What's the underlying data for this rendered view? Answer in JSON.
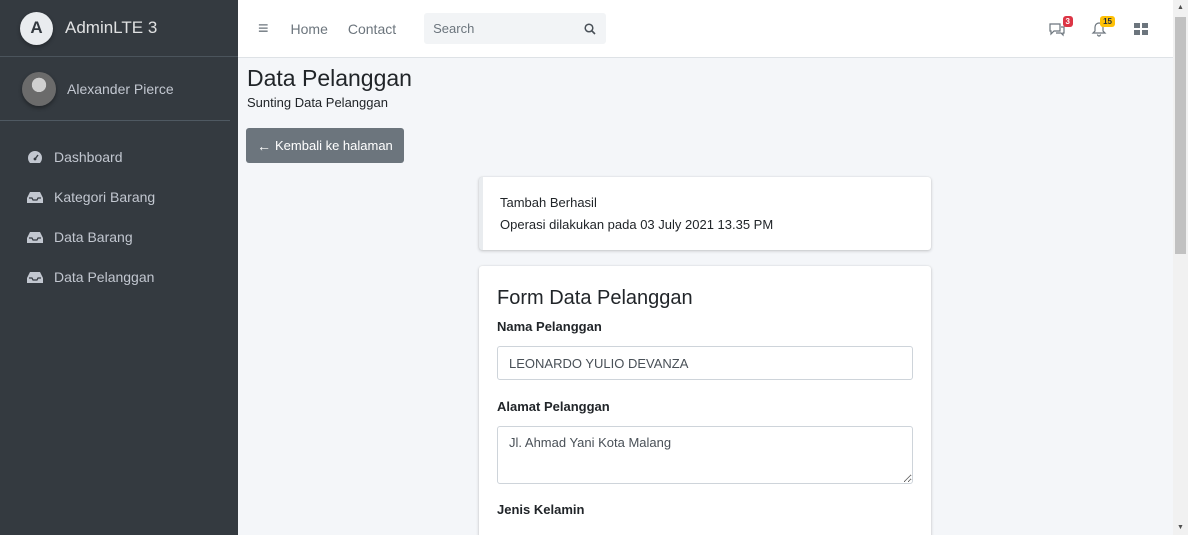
{
  "brand": {
    "name": "AdminLTE 3",
    "logo_letter": "A"
  },
  "user": {
    "name": "Alexander Pierce"
  },
  "sidebar": {
    "items": [
      {
        "label": "Dashboard",
        "icon": "tachometer-icon"
      },
      {
        "label": "Kategori Barang",
        "icon": "inbox-icon"
      },
      {
        "label": "Data Barang",
        "icon": "inbox-icon"
      },
      {
        "label": "Data Pelanggan",
        "icon": "inbox-icon"
      }
    ]
  },
  "topbar": {
    "hamburger_icon": "≡",
    "links": [
      "Home",
      "Contact"
    ],
    "search_placeholder": "Search",
    "messages_count": "3",
    "notifications_count": "15"
  },
  "page": {
    "title": "Data Pelanggan",
    "subtitle": "Sunting Data Pelanggan",
    "back_button": "Kembali ke halaman"
  },
  "alert": {
    "title": "Tambah Berhasil",
    "message": "Operasi dilakukan pada 03 July 2021 13.35 PM"
  },
  "form": {
    "title": "Form Data Pelanggan",
    "nama_label": "Nama Pelanggan",
    "nama_value": "LEONARDO YULIO DEVANZA",
    "alamat_label": "Alamat Pelanggan",
    "alamat_value": "Jl. Ahmad Yani Kota Malang",
    "jenis_label": "Jenis Kelamin"
  },
  "colors": {
    "sidebar_bg": "#343a40",
    "button_secondary": "#6c757d",
    "badge_danger": "#dc3545",
    "badge_warning": "#ffc107"
  }
}
